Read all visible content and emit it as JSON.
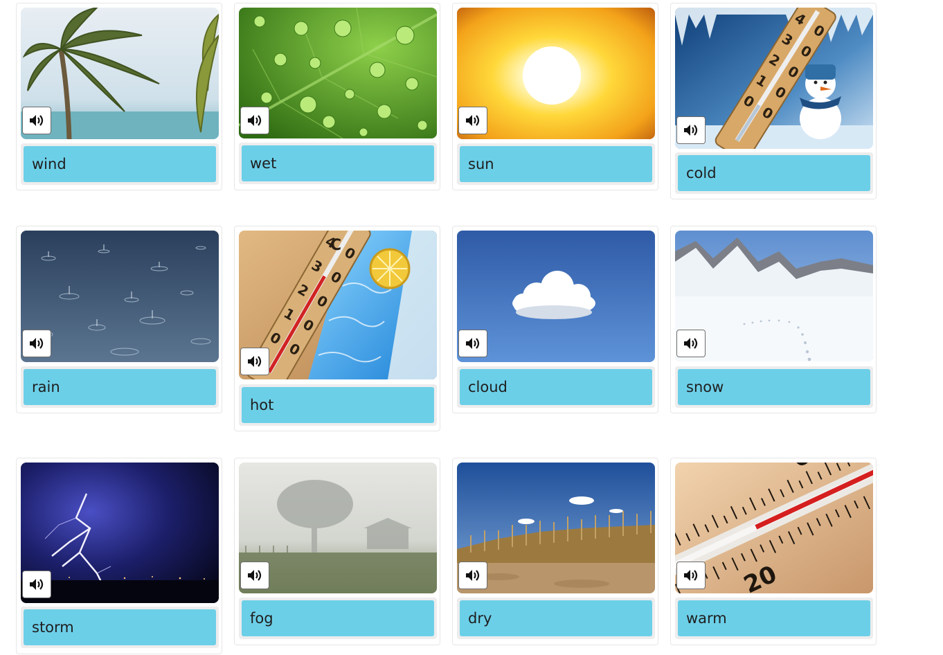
{
  "cards": [
    {
      "word": "wind",
      "image": "palm-tree-in-wind-photo",
      "audio_icon": "speaker-icon"
    },
    {
      "word": "wet",
      "image": "leaf-with-water-drops-photo",
      "audio_icon": "speaker-icon"
    },
    {
      "word": "sun",
      "image": "bright-sun-photo",
      "audio_icon": "speaker-icon"
    },
    {
      "word": "cold",
      "image": "cold-thermometer-snowman-photo",
      "audio_icon": "speaker-icon"
    },
    {
      "word": "rain",
      "image": "rain-on-water-photo",
      "audio_icon": "speaker-icon"
    },
    {
      "word": "hot",
      "image": "hot-thermometer-photo",
      "audio_icon": "speaker-icon"
    },
    {
      "word": "cloud",
      "image": "cloud-in-blue-sky-photo",
      "audio_icon": "speaker-icon"
    },
    {
      "word": "snow",
      "image": "snowy-mountains-photo",
      "audio_icon": "speaker-icon"
    },
    {
      "word": "storm",
      "image": "lightning-storm-photo",
      "audio_icon": "speaker-icon"
    },
    {
      "word": "fog",
      "image": "foggy-field-tree-photo",
      "audio_icon": "speaker-icon"
    },
    {
      "word": "dry",
      "image": "dry-cornfield-photo",
      "audio_icon": "speaker-icon"
    },
    {
      "word": "warm",
      "image": "warm-thermometer-scale-photo",
      "audio_icon": "speaker-icon"
    }
  ],
  "colors": {
    "label_bg": "#6ccfe8",
    "label_tray": "#ededed",
    "card_border": "#e6e6e6"
  }
}
